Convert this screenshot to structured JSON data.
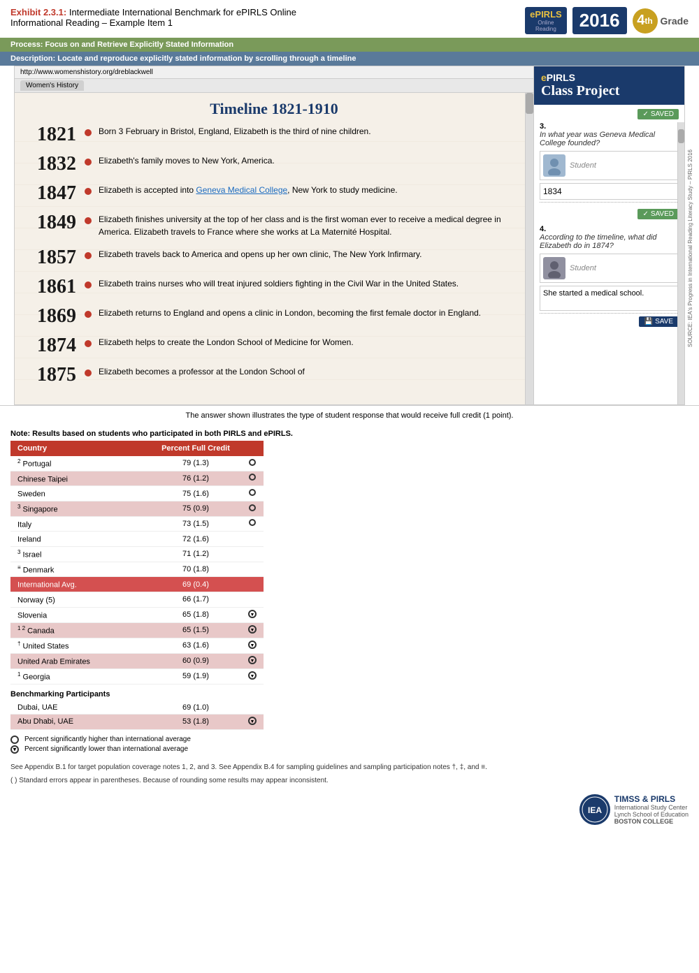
{
  "header": {
    "exhibit_label": "Exhibit 2.3.1:",
    "exhibit_title": "Intermediate International Benchmark for ePIRLS Online",
    "exhibit_subtitle": "Informational Reading – Example Item 1",
    "logo": {
      "epirls": "ePIRLS",
      "online": "Online",
      "reading": "Reading",
      "year": "2016",
      "grade_num": "4th",
      "grade_text": "Grade"
    }
  },
  "bars": {
    "process": "Process: Focus on and Retrieve Explicitly Stated Information",
    "description": "Description: Locate and reproduce explicitly stated information by scrolling through a timeline"
  },
  "browser": {
    "url": "http://www.womenshistory.org/dreblackwell",
    "tab": "Women's History"
  },
  "timeline": {
    "title": "Timeline 1821-1910",
    "entries": [
      {
        "year": "1821",
        "text": "Born 3 February in Bristol, England, Elizabeth is the third of nine children."
      },
      {
        "year": "1832",
        "text": "Elizabeth's family moves to New York, America."
      },
      {
        "year": "1847",
        "text": "Elizabeth is accepted into Geneva Medical College, New York to study medicine.",
        "link": "Geneva Medical College"
      },
      {
        "year": "1849",
        "text": "Elizabeth finishes university at the top of her class and is the first woman ever to receive a medical degree in America. Elizabeth travels to France where she works at La Maternité Hospital."
      },
      {
        "year": "1857",
        "text": "Elizabeth travels back to America and opens up her own clinic, The New York Infirmary."
      },
      {
        "year": "1861",
        "text": "Elizabeth trains nurses who will treat injured soldiers fighting in the Civil War in the United States."
      },
      {
        "year": "1869",
        "text": "Elizabeth returns to England and opens a clinic in London, becoming the first female doctor in England."
      },
      {
        "year": "1874",
        "text": "Elizabeth helps to create the London School of Medicine for Women."
      },
      {
        "year": "1875",
        "text": "Elizabeth becomes a professor at the London School of"
      }
    ]
  },
  "questions_panel": {
    "brand": "ePIRLS",
    "brand_e": "e",
    "class_project": "Class Project",
    "question3": {
      "number": "3.",
      "text": "In what year was Geneva Medical College founded?",
      "student_label": "Student",
      "answer": "1834",
      "saved_label": "SAVED"
    },
    "question4": {
      "number": "4.",
      "text": "According to the timeline, what did Elizabeth do in 1874?",
      "student_label": "Student",
      "answer": "She started a medical school.",
      "save_label": "SAVE"
    }
  },
  "source_label": "SOURCE: IEA's Progress in International Reading Literacy Study – PIRLS 2016",
  "answer_caption": "The answer shown illustrates the type of student response that would receive full credit (1 point).",
  "note": "Note: Results based on students who participated in both PIRLS and ePIRLS.",
  "table": {
    "header_country": "Country",
    "header_percent": "Percent Full Credit",
    "rows": [
      {
        "superscript": "2",
        "country": "Portugal",
        "value": "79 (1.3)",
        "icon": "circle",
        "highlighted": false
      },
      {
        "superscript": "",
        "country": "Chinese Taipei",
        "value": "76 (1.2)",
        "icon": "circle",
        "highlighted": true
      },
      {
        "superscript": "",
        "country": "Sweden",
        "value": "75 (1.6)",
        "icon": "circle",
        "highlighted": false
      },
      {
        "superscript": "3",
        "country": "Singapore",
        "value": "75 (0.9)",
        "icon": "circle",
        "highlighted": true
      },
      {
        "superscript": "",
        "country": "Italy",
        "value": "73 (1.5)",
        "icon": "circle",
        "highlighted": false
      },
      {
        "superscript": "",
        "country": "Ireland",
        "value": "72 (1.6)",
        "icon": "",
        "highlighted": false
      },
      {
        "superscript": "3",
        "country": "Israel",
        "value": "71 (1.2)",
        "icon": "",
        "highlighted": false
      },
      {
        "superscript": "≡",
        "country": "Denmark",
        "value": "70 (1.8)",
        "icon": "",
        "highlighted": false
      },
      {
        "superscript": "",
        "country": "International Avg.",
        "value": "69 (0.4)",
        "icon": "",
        "highlighted": false,
        "international": true
      },
      {
        "superscript": "",
        "country": "Norway (5)",
        "value": "66 (1.7)",
        "icon": "",
        "highlighted": false
      },
      {
        "superscript": "",
        "country": "Slovenia",
        "value": "65 (1.8)",
        "icon": "down",
        "highlighted": false
      },
      {
        "superscript": "1 2",
        "country": "Canada",
        "value": "65 (1.5)",
        "icon": "down",
        "highlighted": true
      },
      {
        "superscript": "†",
        "country": "United States",
        "value": "63 (1.6)",
        "icon": "down",
        "highlighted": false
      },
      {
        "superscript": "",
        "country": "United Arab Emirates",
        "value": "60 (0.9)",
        "icon": "down",
        "highlighted": true
      },
      {
        "superscript": "1",
        "country": "Georgia",
        "value": "59 (1.9)",
        "icon": "down",
        "highlighted": false
      }
    ]
  },
  "benchmarking": {
    "title": "Benchmarking Participants",
    "rows": [
      {
        "country": "Dubai, UAE",
        "value": "69 (1.0)",
        "icon": "",
        "highlighted": false
      },
      {
        "country": "Abu Dhabi, UAE",
        "value": "53 (1.8)",
        "icon": "down",
        "highlighted": true
      }
    ]
  },
  "legend": {
    "circle_label": "Percent significantly higher than international average",
    "down_label": "Percent significantly lower than international average"
  },
  "footnotes": [
    "See Appendix B.1 for target population coverage notes 1, 2, and 3. See Appendix B.4 for sampling guidelines and sampling participation notes †, ‡, and ≡.",
    "( ) Standard errors appear in parentheses. Because of rounding some results may appear inconsistent."
  ],
  "bottom_logo": {
    "timss": "TIMSS & PIRLS",
    "sub1": "International Study Center",
    "sub2": "Lynch School of Education",
    "sub3": "BOSTON COLLEGE",
    "iea": "IEA"
  }
}
